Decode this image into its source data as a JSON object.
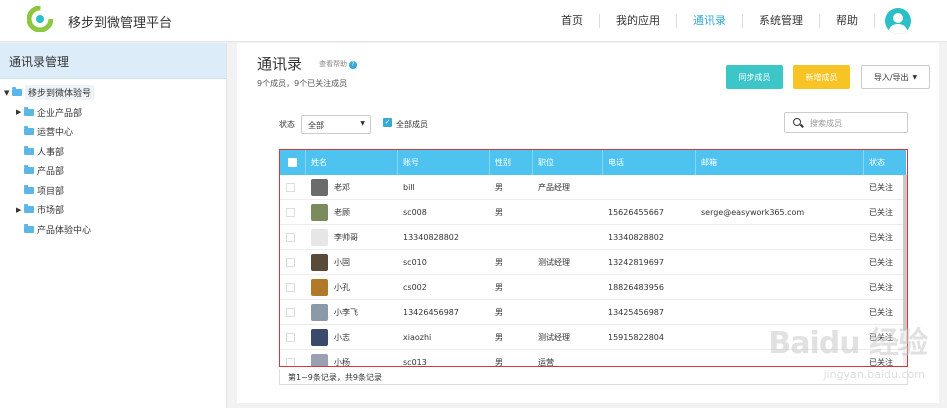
{
  "app": {
    "title": "移步到微管理平台"
  },
  "nav": {
    "items": [
      {
        "label": "首页",
        "active": false
      },
      {
        "label": "我的应用",
        "active": false
      },
      {
        "label": "通讯录",
        "active": true
      },
      {
        "label": "系统管理",
        "active": false
      },
      {
        "label": "帮助",
        "active": false
      }
    ]
  },
  "sidebar": {
    "title": "通讯录管理",
    "tree": [
      {
        "label": "移步到微体验号",
        "level": 0,
        "expanded": true
      },
      {
        "label": "企业产品部",
        "level": 1,
        "has_children": true
      },
      {
        "label": "运营中心",
        "level": 1,
        "has_children": false
      },
      {
        "label": "人事部",
        "level": 1,
        "has_children": false
      },
      {
        "label": "产品部",
        "level": 1,
        "has_children": false
      },
      {
        "label": "项目部",
        "level": 1,
        "has_children": false
      },
      {
        "label": "市场部",
        "level": 1,
        "has_children": true
      },
      {
        "label": "产品体验中心",
        "level": 1,
        "has_children": false
      }
    ]
  },
  "main": {
    "title": "通讯录",
    "help_link": "查看帮助",
    "subtitle": "9个成员，9个已关注成员",
    "buttons": {
      "sync": "同步成员",
      "add": "新增成员",
      "import_export": "导入/导出"
    },
    "filter": {
      "status_label": "状态",
      "status_value": "全部",
      "all_members_label": "全部成员",
      "all_members_checked": true
    },
    "search": {
      "placeholder": "搜索成员"
    }
  },
  "table": {
    "columns": [
      "姓名",
      "账号",
      "性别",
      "职位",
      "电话",
      "邮箱",
      "状态"
    ],
    "rows": [
      {
        "name": "老邓",
        "account": "bill",
        "gender": "男",
        "position": "产品经理",
        "phone": "",
        "email": "",
        "status": "已关注",
        "face": "#6b6b6b"
      },
      {
        "name": "老顾",
        "account": "sc008",
        "gender": "男",
        "position": "",
        "phone": "15626455667",
        "email": "serge@easywork365.com",
        "status": "已关注",
        "face": "#7a8b5c"
      },
      {
        "name": "李帅哥",
        "account": "13340828802",
        "gender": "",
        "position": "",
        "phone": "13340828802",
        "email": "",
        "status": "已关注",
        "face": "#e6e6e6"
      },
      {
        "name": "小固",
        "account": "sc010",
        "gender": "男",
        "position": "测试经理",
        "phone": "13242819697",
        "email": "",
        "status": "已关注",
        "face": "#5a4a3a"
      },
      {
        "name": "小孔",
        "account": "cs002",
        "gender": "男",
        "position": "",
        "phone": "18826483956",
        "email": "",
        "status": "已关注",
        "face": "#b07a2a"
      },
      {
        "name": "小李飞",
        "account": "13426456987",
        "gender": "男",
        "position": "",
        "phone": "13425456987",
        "email": "",
        "status": "已关注",
        "face": "#8a9aa8"
      },
      {
        "name": "小志",
        "account": "xiaozhi",
        "gender": "男",
        "position": "测试经理",
        "phone": "15915822804",
        "email": "",
        "status": "已关注",
        "face": "#3a4a6a"
      },
      {
        "name": "小杨",
        "account": "sc013",
        "gender": "男",
        "position": "运营",
        "phone": "",
        "email": "",
        "status": "已关注",
        "face": "#9aa0b0"
      }
    ]
  },
  "pagination": {
    "text": "第1~9条记录，共9条记录"
  },
  "watermark": {
    "text": "Baidu 经验",
    "sub": "jingyan.baidu.com"
  }
}
